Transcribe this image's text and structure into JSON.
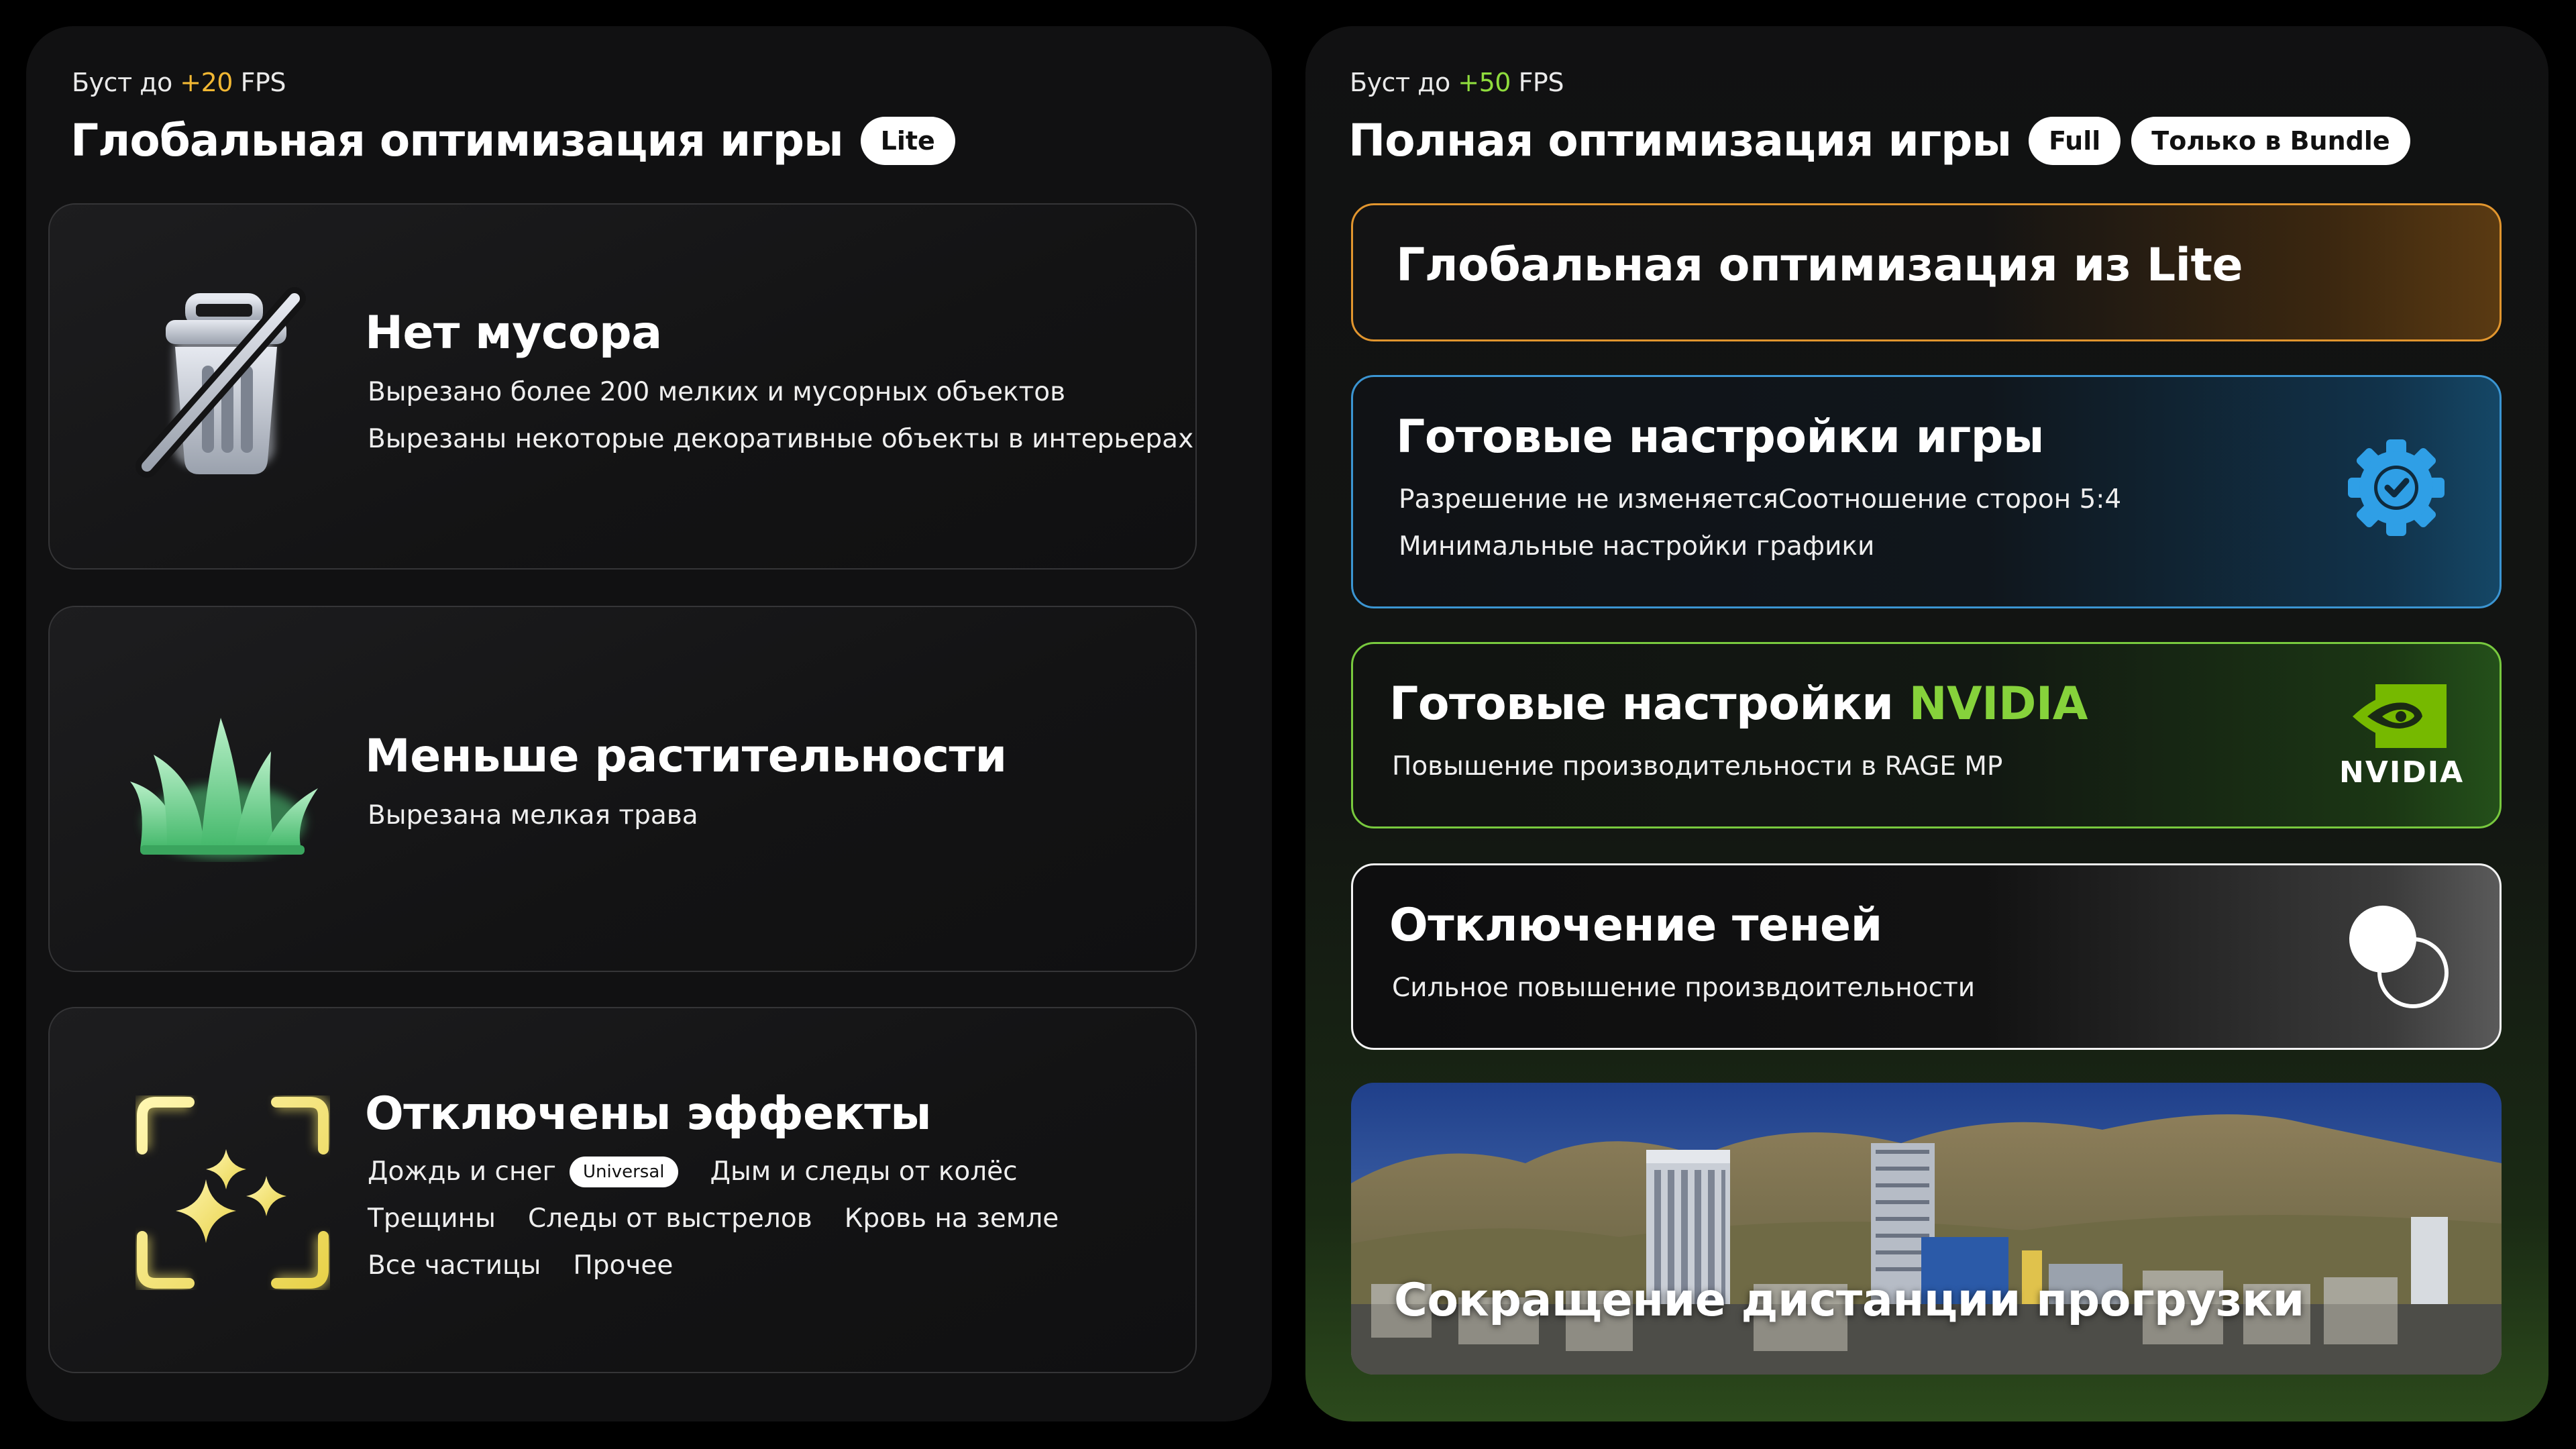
{
  "left": {
    "boost_prefix": "Буст до",
    "boost_value": "+20",
    "boost_suffix": "FPS",
    "title": "Глобальная оптимизация игры",
    "badge": "Lite",
    "cards": [
      {
        "title": "Нет мусора",
        "icon": "trash-crossed-icon",
        "lines": [
          "Вырезано более 200 мелких и мусорных объектов",
          "Вырезаны некоторые декоративные объекты в интерьерах"
        ]
      },
      {
        "title": "Меньше растительности",
        "icon": "grass-icon",
        "lines": [
          "Вырезана мелкая трава"
        ]
      },
      {
        "title": "Отключены эффекты",
        "icon": "sparkles-frame-icon",
        "tags": [
          {
            "label": "Дождь и снег",
            "badge": "Universal"
          },
          {
            "label": "Дым и следы от колёс"
          },
          {
            "label": "Трещины"
          },
          {
            "label": "Следы от выстрелов"
          },
          {
            "label": "Кровь на земле"
          },
          {
            "label": "Все частицы"
          },
          {
            "label": "Прочее"
          }
        ]
      }
    ]
  },
  "right": {
    "boost_prefix": "Буст до",
    "boost_value": "+50",
    "boost_suffix": "FPS",
    "title": "Полная оптимизация игры",
    "badges": [
      "Full",
      "Только в Bundle"
    ],
    "cards": [
      {
        "title": "Глобальная оптимизация из Lite"
      },
      {
        "title": "Готовые настройки игры",
        "icon": "gear-check-icon",
        "lines": [
          "Разрешение не изменяется",
          "Соотношение сторон 5:4",
          "Минимальные настройки графики"
        ]
      },
      {
        "title_prefix": "Готовые настройки",
        "title_highlight": "NVIDIA",
        "icon": "nvidia-logo-icon",
        "logo_text": "NVIDIA",
        "lines": [
          "Повышение производительности в RAGE MP"
        ]
      },
      {
        "title": "Отключение теней",
        "icon": "shadow-circles-icon",
        "lines": [
          "Сильное повышение произвдоительности"
        ]
      },
      {
        "title": "Сокращение дистанции прогрузки",
        "image": "city-skyline-image"
      }
    ]
  },
  "colors": {
    "orange_accent": "#e1952e",
    "blue_accent": "#3b95d2",
    "green_accent": "#78c93e",
    "boost_yellow": "#f1b733",
    "boost_green": "#8fdc3d"
  }
}
